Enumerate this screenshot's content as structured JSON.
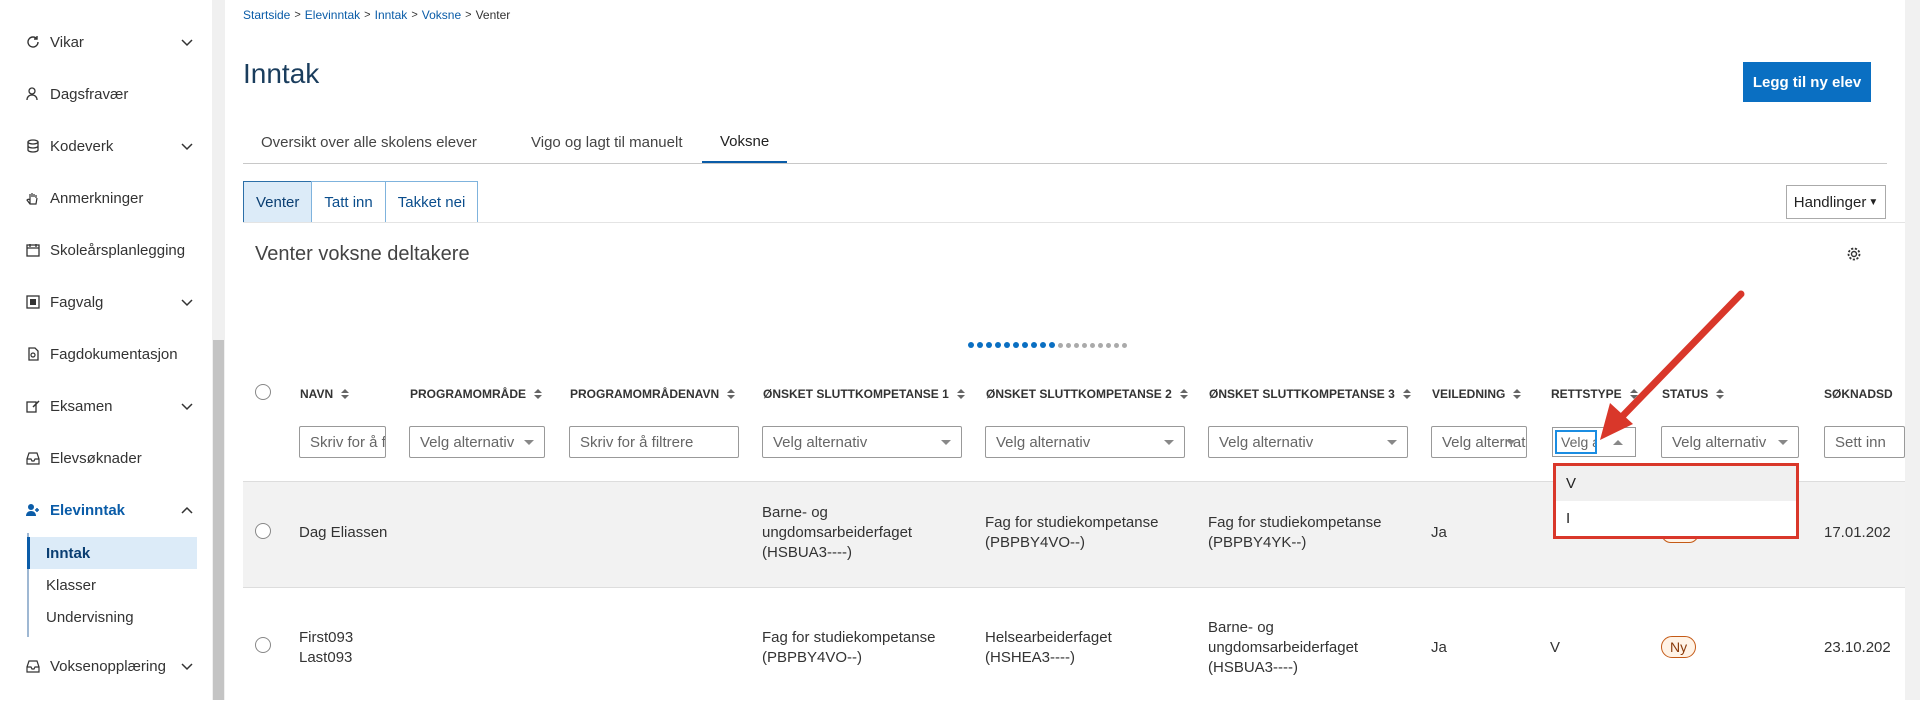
{
  "sidebar": {
    "items": [
      {
        "label": "Vikar",
        "icon": "refresh-icon",
        "chevron": true
      },
      {
        "label": "Dagsfravær",
        "icon": "user-icon",
        "chevron": false
      },
      {
        "label": "Kodeverk",
        "icon": "database-icon",
        "chevron": true
      },
      {
        "label": "Anmerkninger",
        "icon": "hand-icon",
        "chevron": false
      },
      {
        "label": "Skoleårsplanlegging",
        "icon": "calendar-icon",
        "chevron": false
      },
      {
        "label": "Fagvalg",
        "icon": "checkbox-icon",
        "chevron": true
      },
      {
        "label": "Fagdokumentasjon",
        "icon": "document-icon",
        "chevron": false
      },
      {
        "label": "Eksamen",
        "icon": "edit-icon",
        "chevron": true
      },
      {
        "label": "Elevsøknader",
        "icon": "inbox-icon",
        "chevron": false
      },
      {
        "label": "Elevinntak",
        "icon": "user-add-icon",
        "chevron": true
      },
      {
        "label": "Voksenopplæring",
        "icon": "inbox-icon",
        "chevron": true
      }
    ],
    "subitems": [
      "Inntak",
      "Klasser",
      "Undervisning"
    ]
  },
  "breadcrumb": [
    "Startside",
    "Elevinntak",
    "Inntak",
    "Voksne",
    "Venter"
  ],
  "page_title": "Inntak",
  "add_button": "Legg til ny elev",
  "tabs": [
    "Oversikt over alle skolens elever",
    "Vigo og lagt til manuelt",
    "Voksne"
  ],
  "segments": [
    "Venter",
    "Tatt inn",
    "Takket nei"
  ],
  "actions_button": "Handlinger",
  "card_title": "Venter voksne deltakere",
  "columns": [
    "NAVN",
    "PROGRAMOMRÅDE",
    "PROGRAMOMRÅDENAVN",
    "ØNSKET SLUTTKOMPETANSE 1",
    "ØNSKET SLUTTKOMPETANSE 2",
    "ØNSKET SLUTTKOMPETANSE 3",
    "VEILEDNING",
    "RETTSTYPE",
    "STATUS",
    "SØKNADSD"
  ],
  "filters": {
    "navn": "Skriv for å filtrere",
    "programomrade": "Velg alternativ",
    "programomradenavn": "Skriv for å filtrere",
    "sk1": "Velg alternativ",
    "sk2": "Velg alternativ",
    "sk3": "Velg alternativ",
    "veiledning": "Velg alternativ",
    "rettstype": "Velg alternativ",
    "status": "Velg alternativ",
    "dato": "Sett inn"
  },
  "rettstype_options": [
    "V",
    "I"
  ],
  "rows": [
    {
      "navn": "Dag Eliassen",
      "sk1": "Barne- og ungdomsarbeiderfaget (HSBUA3----)",
      "sk2": "Fag for studiekompetanse (PBPBY4VO--)",
      "sk3": "Fag for studiekompetanse (PBPBY4YK--)",
      "veiledning": "Ja",
      "rettstype": "",
      "status": "",
      "dato": "17.01.202"
    },
    {
      "navn_first": "First093",
      "navn_last": "Last093",
      "sk1": "Fag for studiekompetanse (PBPBY4VO--)",
      "sk2": "Helsearbeiderfaget (HSHEA3----)",
      "sk3": "Barne- og ungdomsarbeiderfaget (HSBUA3----)",
      "veiledning": "Ja",
      "rettstype": "V",
      "status": "Ny",
      "dato": "23.10.202"
    }
  ],
  "colors": {
    "accent": "#0a6fc2",
    "highlight": "#d9372a",
    "badge": "#c45a16"
  }
}
